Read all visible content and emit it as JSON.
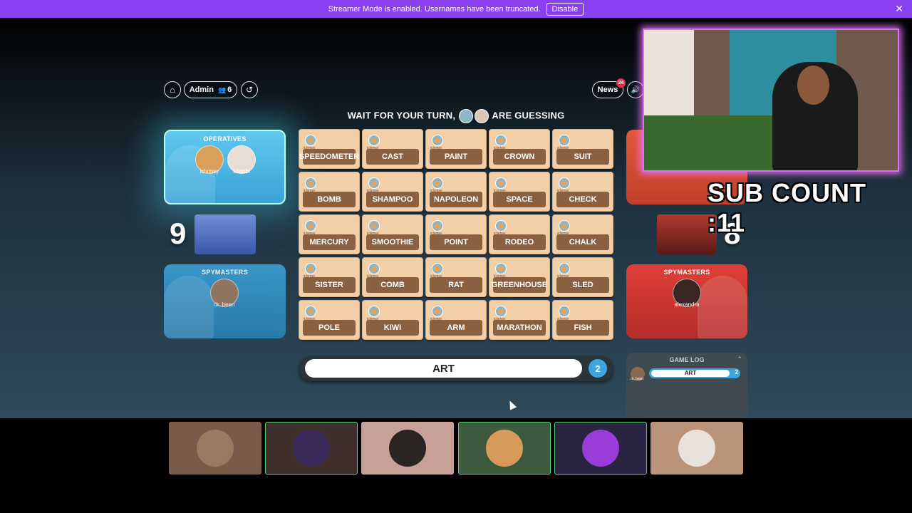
{
  "banner": {
    "text": "Streamer Mode is enabled. Usernames have been truncated.",
    "disable_label": "Disable",
    "close_glyph": "✕",
    "color": "#8a3ff0"
  },
  "toolbar": {
    "home_icon": "⌂",
    "admin_label": "Admin",
    "players_icon": "👥",
    "player_count": "6",
    "reset_icon": "↺",
    "news_label": "News",
    "news_badge": "24",
    "sound_icon": "🔊"
  },
  "status": {
    "prefix": "WAIT FOR YOUR TURN,",
    "suffix": "ARE GUESSING"
  },
  "blue_team": {
    "operatives_title": "OPERATIVES",
    "operatives": [
      "iclvmsy",
      "khobbi"
    ],
    "score": "9",
    "spymasters_title": "SPYMASTERS",
    "spymaster": "dr. bean",
    "color": "#3aa2d6"
  },
  "red_team": {
    "score": "8",
    "spymasters_title": "SPYMASTERS",
    "spymaster": "alexandra",
    "color": "#c23e2a"
  },
  "cards": [
    "SPEEDOMETER",
    "CAST",
    "PAINT",
    "CROWN",
    "SUIT",
    "BOMB",
    "SHAMPOO",
    "NAPOLEON",
    "SPACE",
    "CHECK",
    "MERCURY",
    "SMOOTHIE",
    "POINT",
    "RODEO",
    "CHALK",
    "SISTER",
    "COMB",
    "RAT",
    "GREENHOUSE",
    "SLED",
    "POLE",
    "KIWI",
    "ARM",
    "MARATHON",
    "FISH"
  ],
  "card_vote_label": "iclvmsy",
  "clue": {
    "word": "ART",
    "number": "2"
  },
  "game_log": {
    "title": "GAME LOG",
    "entry_author": "dr. bean",
    "entry_word": "ART",
    "entry_number": "2",
    "chevron": "⌃"
  },
  "overlay": {
    "sub_count": "SUB COUNT :11"
  },
  "participants": [
    {
      "bg": "#7a5a48",
      "face": "#9a7a62",
      "highlight": false
    },
    {
      "bg": "#3e2f2a",
      "face": "#3a2a5a",
      "highlight": true
    },
    {
      "bg": "#c7a197",
      "face": "#2a2422",
      "highlight": false
    },
    {
      "bg": "#3e5a3e",
      "face": "#d89a5a",
      "highlight": true
    },
    {
      "bg": "#2a2440",
      "face": "#9a3cd8",
      "highlight": true
    },
    {
      "bg": "#b99279",
      "face": "#e8e2da",
      "highlight": false
    }
  ]
}
